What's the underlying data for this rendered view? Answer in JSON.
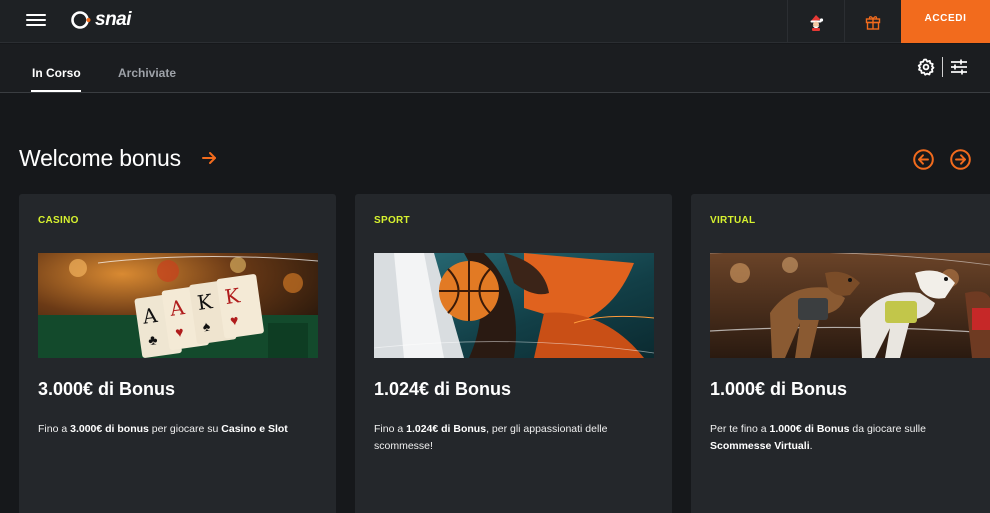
{
  "header": {
    "brand": "snai",
    "login_label": "ACCEDI",
    "icons": [
      "menu-icon",
      "santa-icon",
      "gift-icon"
    ],
    "accent_color": "#f26b1d"
  },
  "tabs": [
    {
      "label": "In Corso",
      "active": true
    },
    {
      "label": "Archiviate",
      "active": false
    }
  ],
  "toolbar_icons": [
    "gear-icon",
    "sliders-icon"
  ],
  "section": {
    "title": "Welcome bonus",
    "icons": [
      "arrow-right-icon",
      "prev-circle-icon",
      "next-circle-icon"
    ]
  },
  "cards": [
    {
      "category": "CASINO",
      "title": "3.000€ di Bonus",
      "desc_parts": [
        "Fino a ",
        "3.000€ di bonus",
        " per giocare su ",
        "Casino e Slot",
        ""
      ],
      "image": "poker-cards-image"
    },
    {
      "category": "SPORT",
      "title": "1.024€ di Bonus",
      "desc_parts": [
        "Fino a ",
        "1.024€ di Bonus",
        ", per gli appassionati delle scommesse!",
        "",
        ""
      ],
      "image": "basketball-image"
    },
    {
      "category": "VIRTUAL",
      "title": "1.000€ di Bonus",
      "desc_parts": [
        "Per te fino a ",
        "1.000€ di Bonus",
        " da giocare sulle ",
        "Scommesse Virtuali",
        "."
      ],
      "image": "greyhound-racing-image"
    }
  ],
  "category_color": "#d7f22f"
}
